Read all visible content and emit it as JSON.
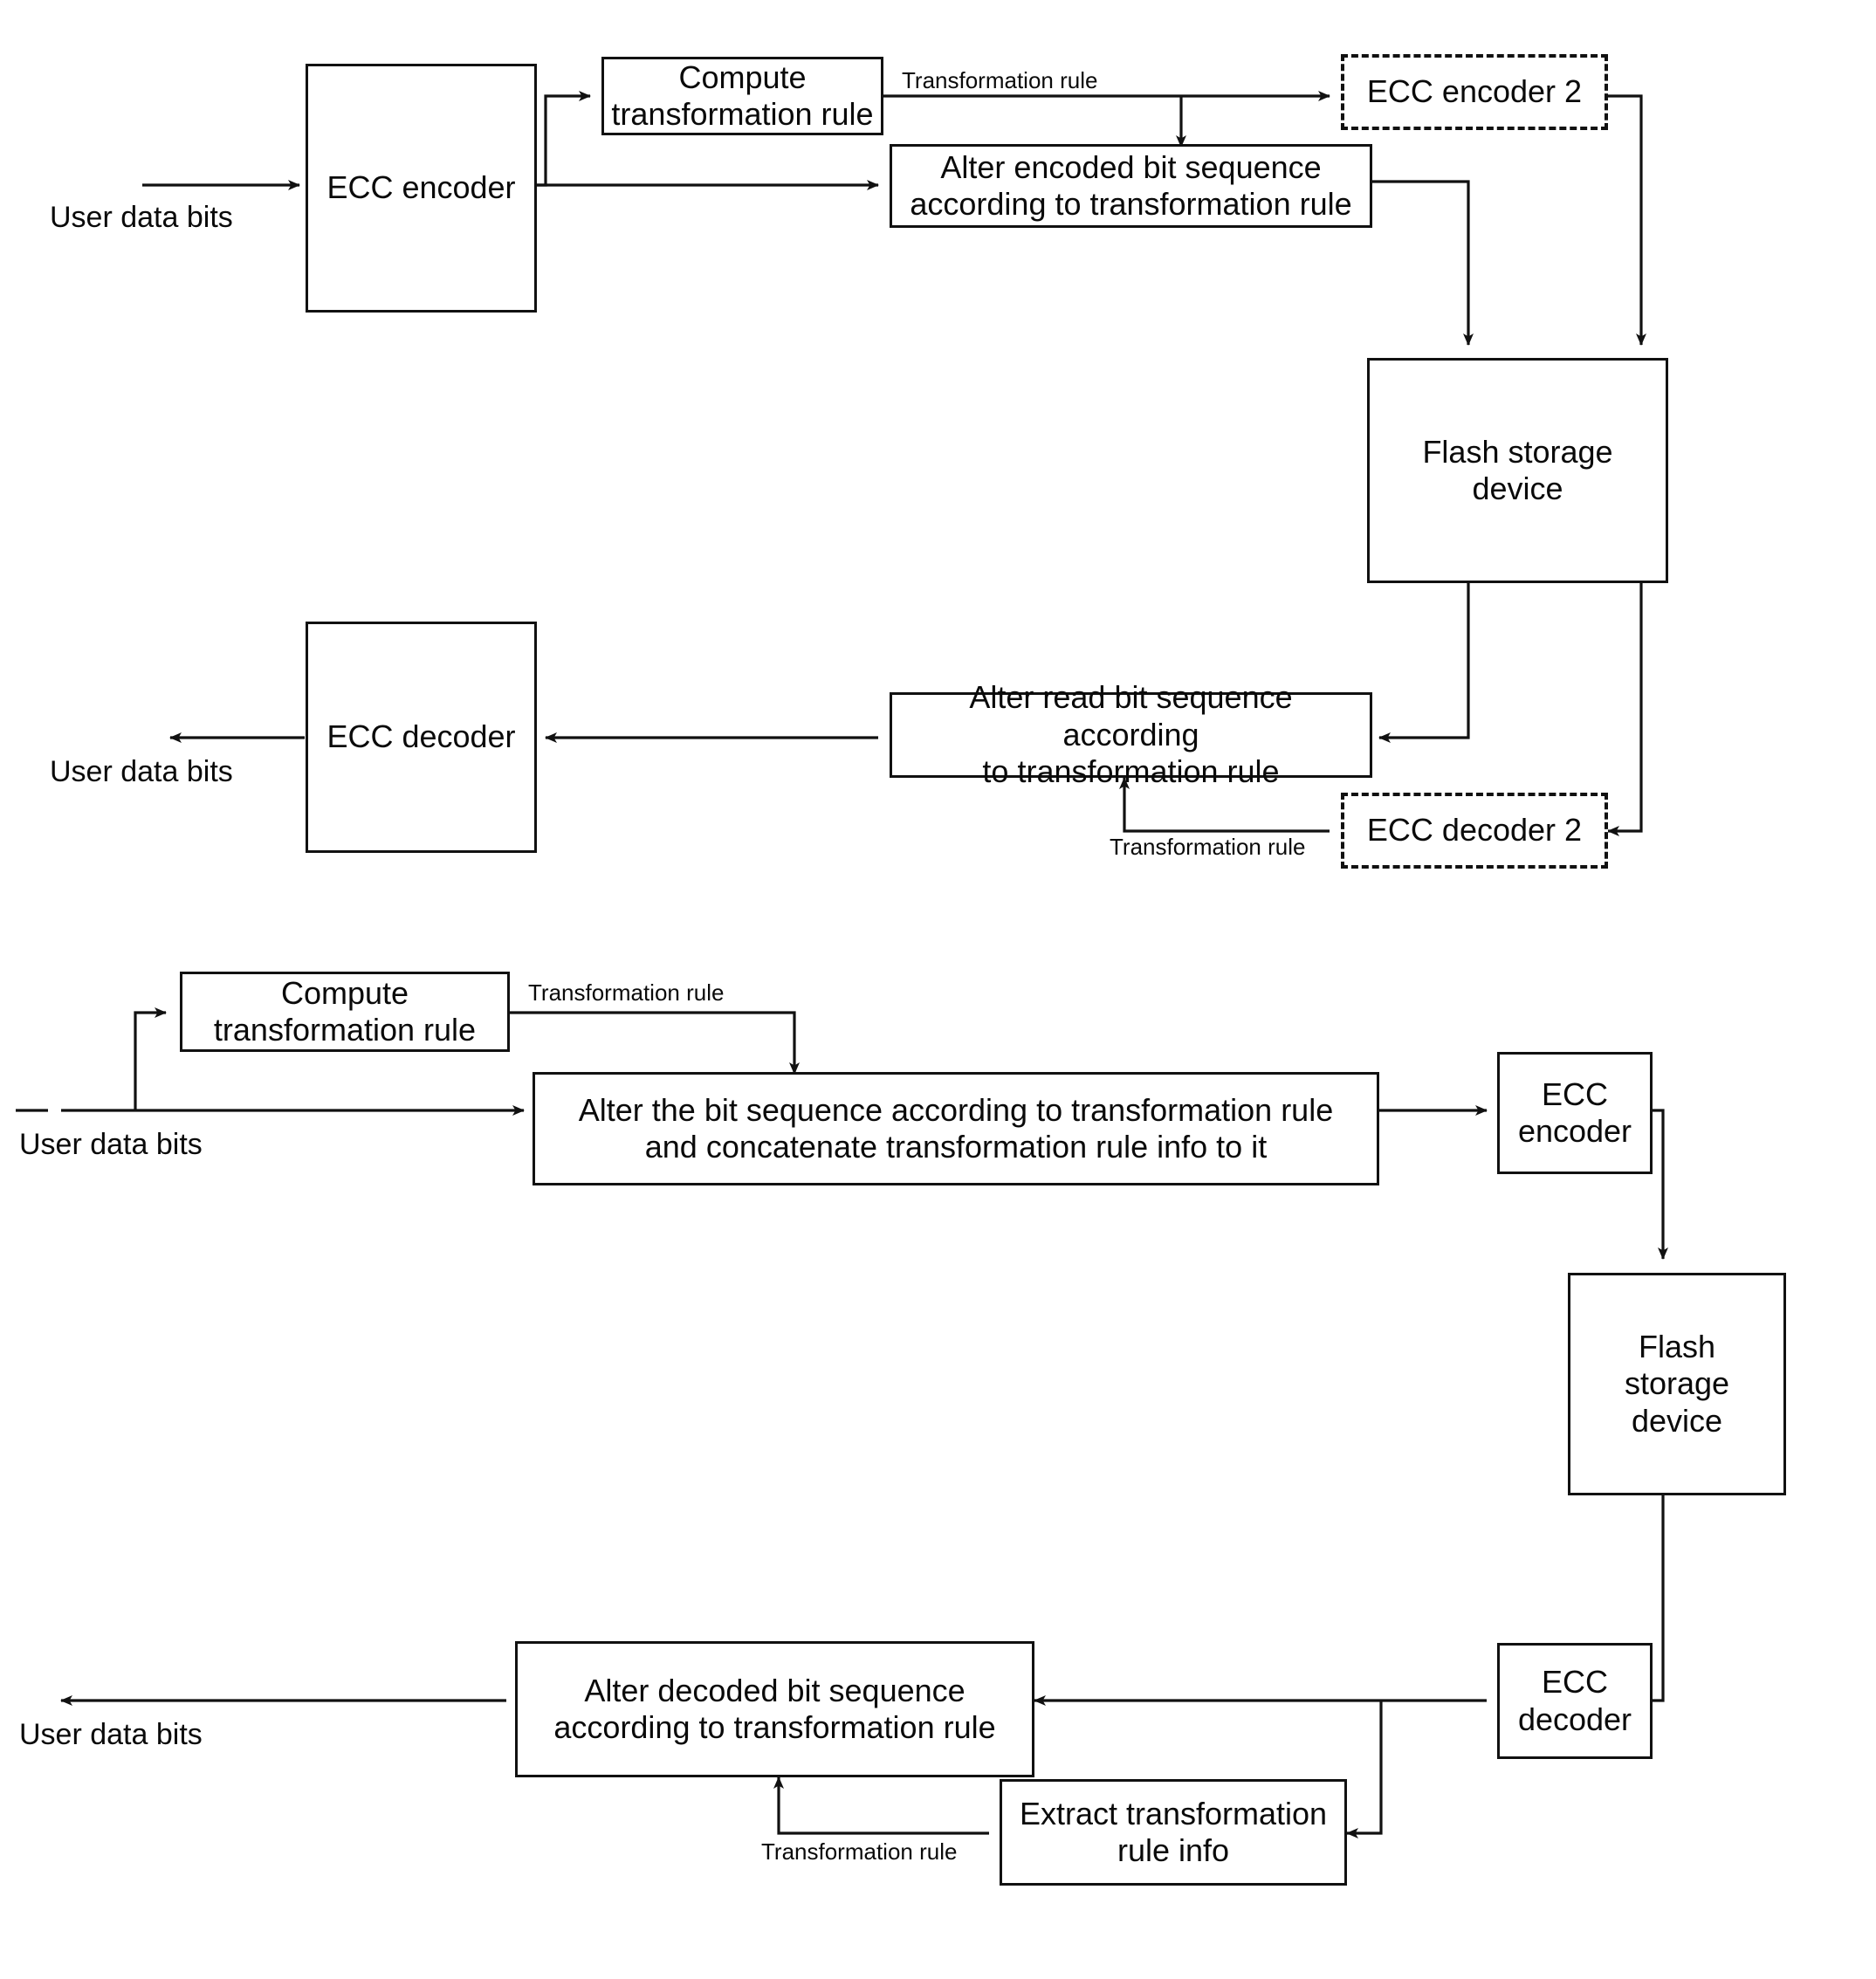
{
  "figure": {
    "type": "block-diagram",
    "description": "Two flash-memory ECC block diagrams showing transformation-rule based bit sequence alteration"
  },
  "diagram1": {
    "nodes": {
      "ecc_encoder": "ECC encoder",
      "compute_rule": "Compute\ntransformation rule",
      "alter_encoded": "Alter encoded bit sequence\naccording to transformation rule",
      "ecc_encoder_2": "ECC encoder 2",
      "flash_storage": "Flash storage\ndevice",
      "alter_read": "Alter read bit sequence according\nto transformation rule",
      "ecc_decoder_2": "ECC decoder 2",
      "ecc_decoder": "ECC decoder"
    },
    "labels": {
      "user_data_in": "User data bits",
      "user_data_out": "User data bits",
      "rule_top": "Transformation rule",
      "rule_bottom": "Transformation rule"
    }
  },
  "diagram2": {
    "nodes": {
      "compute_rule": "Compute\ntransformation rule",
      "alter_concat": "Alter the bit sequence according to transformation rule\nand concatenate transformation rule info to it",
      "ecc_encoder": "ECC\nencoder",
      "flash_storage": "Flash\nstorage\ndevice",
      "ecc_decoder": "ECC\ndecoder",
      "alter_decoded": "Alter decoded bit sequence\naccording to transformation rule",
      "extract_rule": "Extract transformation\nrule info"
    },
    "labels": {
      "user_data_in": "User data bits",
      "user_data_out": "User data bits",
      "rule_top": "Transformation rule",
      "rule_bottom": "Transformation rule"
    }
  },
  "colors": {
    "ink": "#111111",
    "paper": "#ffffff"
  }
}
